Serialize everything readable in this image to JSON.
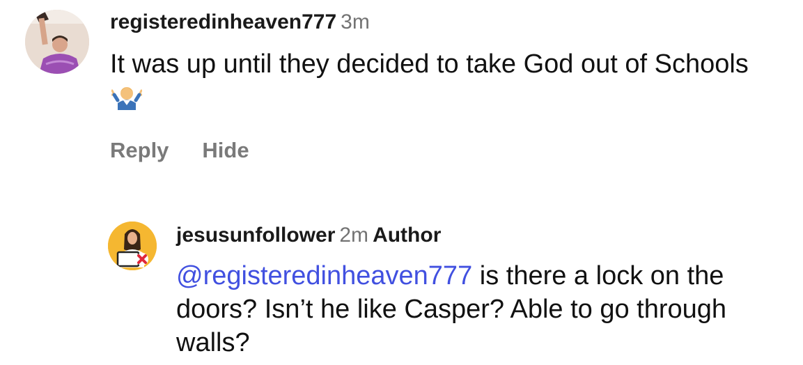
{
  "comments": [
    {
      "username": "registeredinheaven777",
      "time": "3m",
      "text": "It was up until they decided to take God out of Schools",
      "emoji": "person-shrugging-emoji",
      "actions": {
        "reply": "Reply",
        "hide": "Hide"
      }
    },
    {
      "username": "jesusunfollower",
      "time": "2m",
      "badge": "Author",
      "mention": "@registeredinheaven777",
      "text": " is there a lock on the doors? Isn’t he like Casper? Able to go through walls?"
    }
  ]
}
